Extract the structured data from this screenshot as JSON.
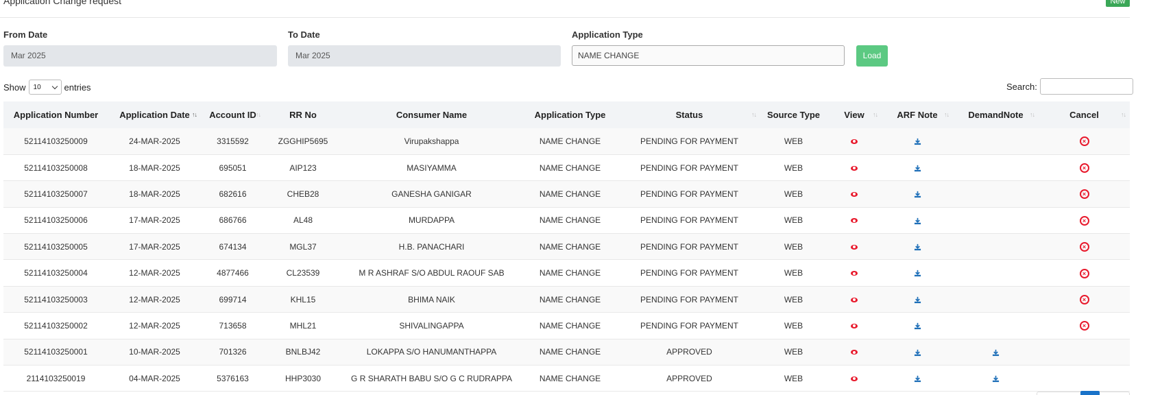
{
  "header": {
    "title": "Application Change request",
    "new_label": "New"
  },
  "filters": {
    "from_label": "From Date",
    "from_value": "Mar 2025",
    "to_label": "To Date",
    "to_value": "Mar 2025",
    "type_label": "Application Type",
    "type_value": "NAME CHANGE",
    "load_label": "Load"
  },
  "table_controls": {
    "show_label": "Show",
    "entries_value": "10",
    "entries_label": "entries",
    "search_label": "Search:"
  },
  "columns": [
    "Application Number",
    "Application Date",
    "Account ID",
    "RR No",
    "Consumer Name",
    "Application Type",
    "Status",
    "Source Type",
    "View",
    "ARF Note",
    "DemandNote",
    "Cancel"
  ],
  "rows": [
    {
      "app_no": "52114103250009",
      "date": "24-MAR-2025",
      "account": "3315592",
      "rr": "ZGGHIP5695",
      "name": "Virupakshappa",
      "type": "NAME CHANGE",
      "status": "PENDING FOR PAYMENT",
      "source": "WEB",
      "demand": false,
      "cancel": true
    },
    {
      "app_no": "52114103250008",
      "date": "18-MAR-2025",
      "account": "695051",
      "rr": "AIP123",
      "name": "MASIYAMMA",
      "type": "NAME CHANGE",
      "status": "PENDING FOR PAYMENT",
      "source": "WEB",
      "demand": false,
      "cancel": true
    },
    {
      "app_no": "52114103250007",
      "date": "18-MAR-2025",
      "account": "682616",
      "rr": "CHEB28",
      "name": "GANESHA GANIGAR",
      "type": "NAME CHANGE",
      "status": "PENDING FOR PAYMENT",
      "source": "WEB",
      "demand": false,
      "cancel": true
    },
    {
      "app_no": "52114103250006",
      "date": "17-MAR-2025",
      "account": "686766",
      "rr": "AL48",
      "name": "MURDAPPA",
      "type": "NAME CHANGE",
      "status": "PENDING FOR PAYMENT",
      "source": "WEB",
      "demand": false,
      "cancel": true
    },
    {
      "app_no": "52114103250005",
      "date": "17-MAR-2025",
      "account": "674134",
      "rr": "MGL37",
      "name": "H.B. PANACHARI",
      "type": "NAME CHANGE",
      "status": "PENDING FOR PAYMENT",
      "source": "WEB",
      "demand": false,
      "cancel": true
    },
    {
      "app_no": "52114103250004",
      "date": "12-MAR-2025",
      "account": "4877466",
      "rr": "CL23539",
      "name": "M R ASHRAF S/O ABDUL RAOUF SAB",
      "type": "NAME CHANGE",
      "status": "PENDING FOR PAYMENT",
      "source": "WEB",
      "demand": false,
      "cancel": true
    },
    {
      "app_no": "52114103250003",
      "date": "12-MAR-2025",
      "account": "699714",
      "rr": "KHL15",
      "name": "BHIMA NAIK",
      "type": "NAME CHANGE",
      "status": "PENDING FOR PAYMENT",
      "source": "WEB",
      "demand": false,
      "cancel": true
    },
    {
      "app_no": "52114103250002",
      "date": "12-MAR-2025",
      "account": "713658",
      "rr": "MHL21",
      "name": "SHIVALINGAPPA",
      "type": "NAME CHANGE",
      "status": "PENDING FOR PAYMENT",
      "source": "WEB",
      "demand": false,
      "cancel": true
    },
    {
      "app_no": "52114103250001",
      "date": "10-MAR-2025",
      "account": "701326",
      "rr": "BNLBJ42",
      "name": "LOKAPPA S/O HANUMANTHAPPA",
      "type": "NAME CHANGE",
      "status": "APPROVED",
      "source": "WEB",
      "demand": true,
      "cancel": false
    },
    {
      "app_no": "2114103250019",
      "date": "04-MAR-2025",
      "account": "5376163",
      "rr": "HHP3030",
      "name": "G R SHARATH BABU S/O G C RUDRAPPA",
      "type": "NAME CHANGE",
      "status": "APPROVED",
      "source": "WEB",
      "demand": true,
      "cancel": false
    }
  ],
  "colors": {
    "accent_green": "#3aa757",
    "load_green": "#5cc982",
    "icon_red": "#e8192c",
    "icon_blue": "#1e6fb8"
  }
}
